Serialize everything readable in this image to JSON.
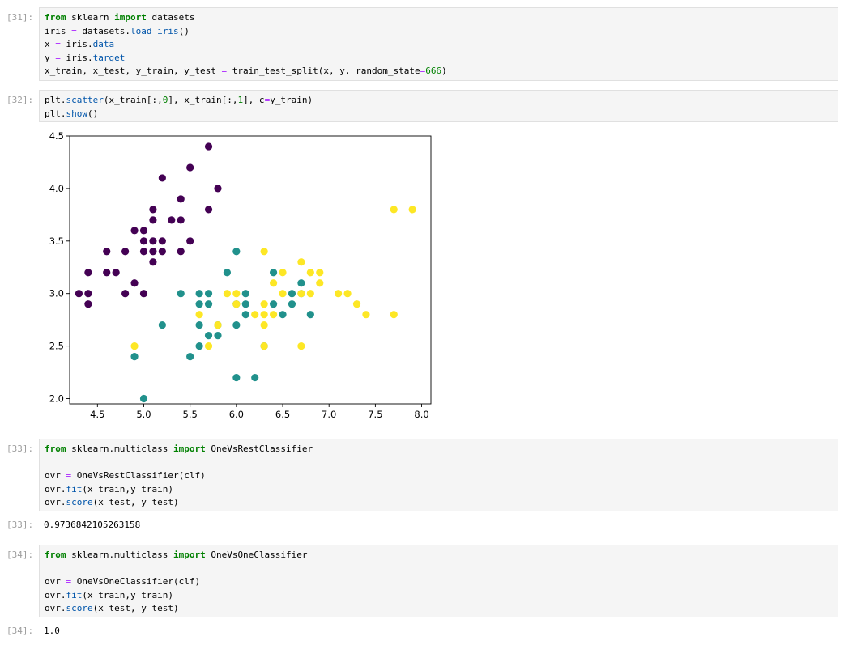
{
  "cells": [
    {
      "prompt": "[31]:",
      "lines": [
        [
          {
            "t": "from",
            "c": "kw"
          },
          {
            "t": " sklearn "
          },
          {
            "t": "import",
            "c": "kw"
          },
          {
            "t": " datasets"
          }
        ],
        [
          {
            "t": "iris "
          },
          {
            "t": "=",
            "c": "op"
          },
          {
            "t": " datasets."
          },
          {
            "t": "load_iris",
            "c": "fn"
          },
          {
            "t": "()"
          }
        ],
        [
          {
            "t": "x "
          },
          {
            "t": "=",
            "c": "op"
          },
          {
            "t": " iris."
          },
          {
            "t": "data",
            "c": "fn"
          }
        ],
        [
          {
            "t": "y "
          },
          {
            "t": "=",
            "c": "op"
          },
          {
            "t": " iris."
          },
          {
            "t": "target",
            "c": "fn"
          }
        ],
        [
          {
            "t": "x_train, x_test, y_train, y_test "
          },
          {
            "t": "=",
            "c": "op"
          },
          {
            "t": " train_test_split(x, y, random_state"
          },
          {
            "t": "=",
            "c": "op"
          },
          {
            "t": "666",
            "c": "num"
          },
          {
            "t": ")"
          }
        ]
      ]
    },
    {
      "prompt": "[32]:",
      "lines": [
        [
          {
            "t": "plt."
          },
          {
            "t": "scatter",
            "c": "fn"
          },
          {
            "t": "(x_train[:,"
          },
          {
            "t": "0",
            "c": "num"
          },
          {
            "t": "], x_train[:,"
          },
          {
            "t": "1",
            "c": "num"
          },
          {
            "t": "], c"
          },
          {
            "t": "=",
            "c": "op"
          },
          {
            "t": "y_train)"
          }
        ],
        [
          {
            "t": "plt."
          },
          {
            "t": "show",
            "c": "fn"
          },
          {
            "t": "()"
          }
        ]
      ]
    },
    {
      "prompt": "[33]:",
      "lines": [
        [
          {
            "t": "from",
            "c": "kw"
          },
          {
            "t": " sklearn.multiclass "
          },
          {
            "t": "import",
            "c": "kw"
          },
          {
            "t": " OneVsRestClassifier"
          }
        ],
        [
          {
            "t": ""
          }
        ],
        [
          {
            "t": "ovr "
          },
          {
            "t": "=",
            "c": "op"
          },
          {
            "t": " OneVsRestClassifier(clf)"
          }
        ],
        [
          {
            "t": "ovr."
          },
          {
            "t": "fit",
            "c": "fn"
          },
          {
            "t": "(x_train,y_train)"
          }
        ],
        [
          {
            "t": "ovr."
          },
          {
            "t": "score",
            "c": "fn"
          },
          {
            "t": "(x_test, y_test)"
          }
        ]
      ]
    },
    {
      "prompt": "[34]:",
      "lines": [
        [
          {
            "t": "from",
            "c": "kw"
          },
          {
            "t": " sklearn.multiclass "
          },
          {
            "t": "import",
            "c": "kw"
          },
          {
            "t": " OneVsOneClassifier"
          }
        ],
        [
          {
            "t": ""
          }
        ],
        [
          {
            "t": "ovr "
          },
          {
            "t": "=",
            "c": "op"
          },
          {
            "t": " OneVsOneClassifier(clf)"
          }
        ],
        [
          {
            "t": "ovr."
          },
          {
            "t": "fit",
            "c": "fn"
          },
          {
            "t": "(x_train,y_train)"
          }
        ],
        [
          {
            "t": "ovr."
          },
          {
            "t": "score",
            "c": "fn"
          },
          {
            "t": "(x_test, y_test)"
          }
        ]
      ]
    }
  ],
  "outputs": [
    {
      "prompt": "[33]:",
      "text": "0.9736842105263158"
    },
    {
      "prompt": "[34]:",
      "text": "1.0"
    }
  ],
  "colors": {
    "class_0": "#440154",
    "class_1": "#21918c",
    "class_2": "#fde725",
    "keyword": "#008000",
    "function": "#0055aa",
    "operator": "#aa22ff",
    "number": "#008000",
    "prompt": "#9e9e9e"
  },
  "chart_data": {
    "type": "scatter",
    "title": "",
    "xlabel": "",
    "ylabel": "",
    "xlim": [
      4.2,
      8.1
    ],
    "ylim": [
      1.95,
      4.5
    ],
    "xticks": [
      "4.5",
      "5.0",
      "5.5",
      "6.0",
      "6.5",
      "7.0",
      "7.5",
      "8.0"
    ],
    "yticks": [
      "2.0",
      "2.5",
      "3.0",
      "3.5",
      "4.0",
      "4.5"
    ],
    "grid": false,
    "series": [
      {
        "class": 0,
        "points": [
          [
            4.3,
            3.0
          ],
          [
            4.4,
            3.0
          ],
          [
            4.4,
            3.2
          ],
          [
            4.4,
            2.9
          ],
          [
            4.6,
            3.4
          ],
          [
            4.6,
            3.2
          ],
          [
            4.7,
            3.2
          ],
          [
            4.8,
            3.4
          ],
          [
            4.8,
            3.0
          ],
          [
            4.9,
            3.6
          ],
          [
            4.9,
            3.1
          ],
          [
            5.0,
            3.6
          ],
          [
            5.0,
            3.5
          ],
          [
            5.0,
            3.4
          ],
          [
            5.0,
            3.0
          ],
          [
            5.1,
            3.8
          ],
          [
            5.1,
            3.7
          ],
          [
            5.1,
            3.5
          ],
          [
            5.1,
            3.4
          ],
          [
            5.1,
            3.3
          ],
          [
            5.2,
            4.1
          ],
          [
            5.2,
            3.5
          ],
          [
            5.2,
            3.4
          ],
          [
            5.3,
            3.7
          ],
          [
            5.4,
            3.9
          ],
          [
            5.4,
            3.7
          ],
          [
            5.4,
            3.4
          ],
          [
            5.5,
            4.2
          ],
          [
            5.5,
            3.5
          ],
          [
            5.7,
            4.4
          ],
          [
            5.7,
            3.8
          ],
          [
            5.8,
            4.0
          ]
        ]
      },
      {
        "class": 1,
        "points": [
          [
            4.9,
            2.4
          ],
          [
            5.0,
            2.0
          ],
          [
            5.2,
            2.7
          ],
          [
            5.4,
            3.0
          ],
          [
            5.5,
            2.4
          ],
          [
            5.6,
            3.0
          ],
          [
            5.6,
            2.9
          ],
          [
            5.6,
            2.7
          ],
          [
            5.6,
            2.5
          ],
          [
            5.7,
            3.0
          ],
          [
            5.7,
            2.9
          ],
          [
            5.7,
            2.6
          ],
          [
            5.8,
            2.7
          ],
          [
            5.8,
            2.6
          ],
          [
            5.9,
            3.2
          ],
          [
            6.0,
            3.4
          ],
          [
            6.0,
            2.9
          ],
          [
            6.0,
            2.7
          ],
          [
            6.0,
            2.2
          ],
          [
            6.1,
            3.0
          ],
          [
            6.1,
            2.9
          ],
          [
            6.1,
            2.8
          ],
          [
            6.2,
            2.2
          ],
          [
            6.3,
            2.5
          ],
          [
            6.4,
            3.2
          ],
          [
            6.4,
            2.9
          ],
          [
            6.5,
            2.8
          ],
          [
            6.6,
            3.0
          ],
          [
            6.6,
            2.9
          ],
          [
            6.7,
            3.1
          ],
          [
            6.7,
            3.0
          ],
          [
            6.8,
            2.8
          ]
        ]
      },
      {
        "class": 2,
        "points": [
          [
            4.9,
            2.5
          ],
          [
            5.6,
            2.8
          ],
          [
            5.7,
            2.5
          ],
          [
            5.8,
            2.7
          ],
          [
            5.9,
            3.0
          ],
          [
            6.0,
            3.0
          ],
          [
            6.0,
            2.9
          ],
          [
            6.2,
            2.8
          ],
          [
            6.3,
            3.4
          ],
          [
            6.3,
            2.9
          ],
          [
            6.3,
            2.8
          ],
          [
            6.3,
            2.7
          ],
          [
            6.3,
            2.5
          ],
          [
            6.4,
            3.1
          ],
          [
            6.4,
            2.8
          ],
          [
            6.5,
            3.2
          ],
          [
            6.5,
            3.0
          ],
          [
            6.7,
            3.3
          ],
          [
            6.7,
            3.0
          ],
          [
            6.7,
            2.5
          ],
          [
            6.8,
            3.2
          ],
          [
            6.8,
            3.0
          ],
          [
            6.9,
            3.2
          ],
          [
            6.9,
            3.1
          ],
          [
            7.1,
            3.0
          ],
          [
            7.2,
            3.0
          ],
          [
            7.3,
            2.9
          ],
          [
            7.4,
            2.8
          ],
          [
            7.7,
            3.8
          ],
          [
            7.7,
            2.8
          ],
          [
            7.9,
            3.8
          ]
        ]
      }
    ]
  }
}
